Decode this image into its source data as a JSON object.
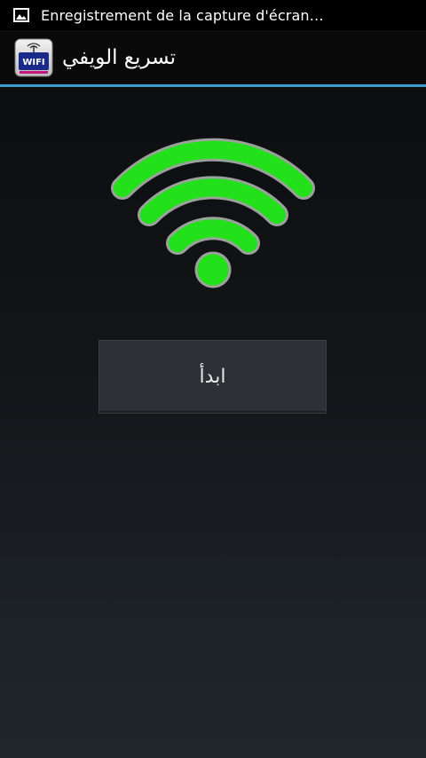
{
  "status_bar": {
    "notification_icon": "image-icon",
    "notification_text": "Enregistrement de la capture d'écran…"
  },
  "action_bar": {
    "app_icon": "wifi-router-app-icon",
    "app_icon_label": "WIFI",
    "title": "تسريع الويفي",
    "divider_color": "#3a9ec8"
  },
  "main": {
    "graphic_icon": "wifi-signal-icon",
    "graphic_color": "#22e01a",
    "start_button_label": "ابدأ"
  }
}
